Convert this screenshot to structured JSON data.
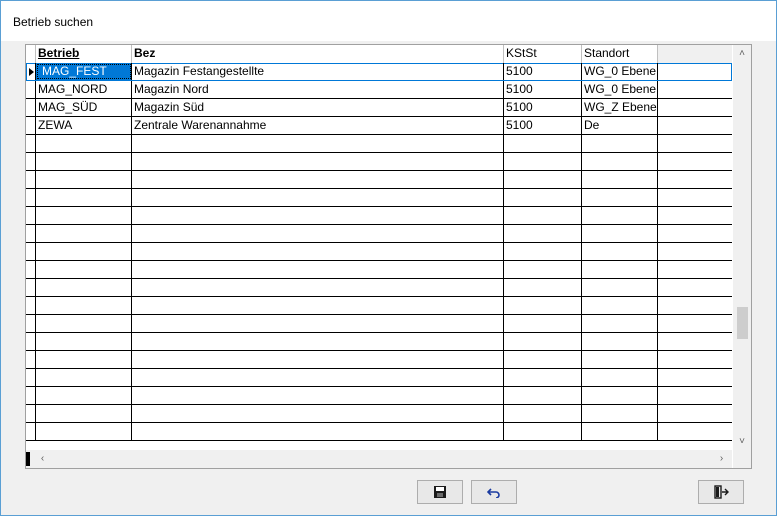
{
  "window": {
    "title": "Betrieb suchen"
  },
  "grid": {
    "columns": [
      {
        "key": "betrieb",
        "label": "Betrieb",
        "active": true
      },
      {
        "key": "bez",
        "label": "Bez",
        "active": false
      },
      {
        "key": "kstst",
        "label": "KStSt",
        "active": false
      },
      {
        "key": "standort",
        "label": "Standort",
        "active": false
      }
    ],
    "rows": [
      {
        "betrieb": "MAG_FEST",
        "bez": "Magazin Festangestellte",
        "kstst": "5100",
        "standort": "WG_0 Ebene"
      },
      {
        "betrieb": "MAG_NORD",
        "bez": "Magazin Nord",
        "kstst": "5100",
        "standort": "WG_0 Ebene"
      },
      {
        "betrieb": "MAG_SÜD",
        "bez": "Magazin Süd",
        "kstst": "5100",
        "standort": "WG_Z Ebene"
      },
      {
        "betrieb": "ZEWA",
        "bez": "Zentrale Warenannahme",
        "kstst": "5100",
        "standort": "De"
      }
    ],
    "empty_row_count": 17,
    "selected_row": 0
  },
  "buttons": {
    "save_icon": "save-icon",
    "undo_icon": "undo-icon",
    "exit_icon": "exit-door-icon"
  },
  "colors": {
    "selection": "#0078d7",
    "window_border": "#5a9fd4"
  }
}
